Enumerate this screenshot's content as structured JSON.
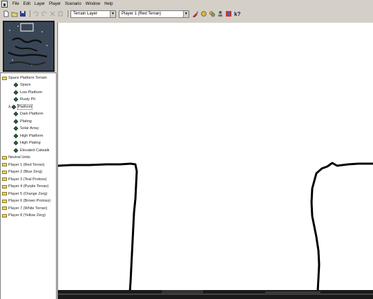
{
  "menu": [
    "File",
    "Edit",
    "Layer",
    "Player",
    "Scenario",
    "Window",
    "Help"
  ],
  "toolbar": {
    "layer_select": "Terrain Layer",
    "player_select": "Player 1  (Red Terran)"
  },
  "tree": {
    "root": "Space Platform Terrain",
    "terrain_items": [
      "Space",
      "Low Platform",
      "Rusty Pit",
      "Platform",
      "Dark Platform",
      "Plating",
      "Solar Array",
      "High Platform",
      "High Plating",
      "Elevated Catwalk"
    ],
    "selected": "Platform",
    "folders": [
      "Neutral Units",
      "Player 1  (Red Terran)",
      "Player 2  (Blue Zerg)",
      "Player 3  (Teal Protoss)",
      "Player 4  (Purple Terran)",
      "Player 5  (Orange Zerg)",
      "Player 6  (Brown Protoss)",
      "Player 7  (White Terran)",
      "Player 8  (Yellow Zerg)"
    ]
  },
  "colors": {
    "tree_folder": "#e8d36a",
    "tile": "#2d6a2d",
    "canvas": "#ffffff",
    "minimap": "#3a4656"
  }
}
